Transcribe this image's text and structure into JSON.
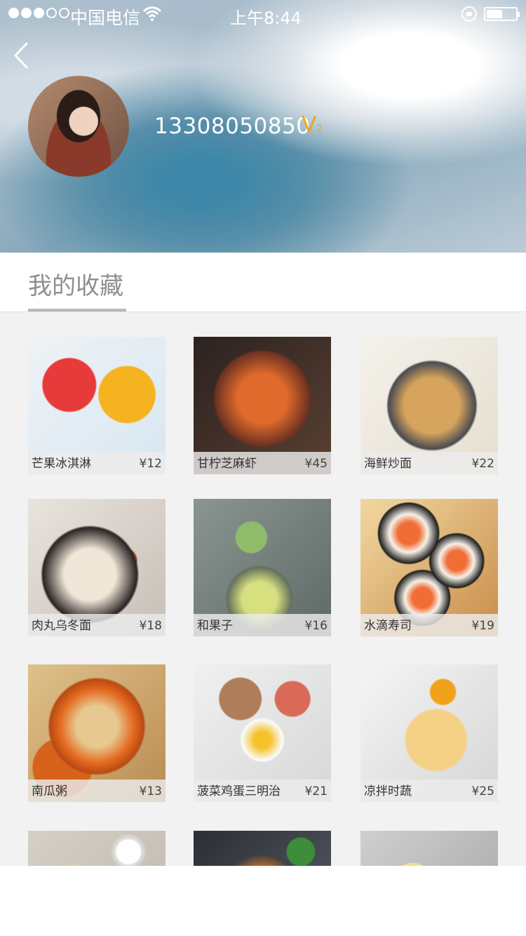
{
  "status_bar": {
    "carrier": "中国电信",
    "time": "上午8:44",
    "signal_bars": 3,
    "battery_level": 0.45
  },
  "profile": {
    "phone": "13308050850",
    "vip": "V",
    "vip_level": "2"
  },
  "section": {
    "title": "我的收藏"
  },
  "favorites": [
    {
      "name": "芒果冰淇淋",
      "price": "¥12"
    },
    {
      "name": "甘柠芝麻虾",
      "price": "¥45"
    },
    {
      "name": "海鲜炒面",
      "price": "¥22"
    },
    {
      "name": "肉丸乌冬面",
      "price": "¥18"
    },
    {
      "name": "和果子",
      "price": "¥16"
    },
    {
      "name": "水滴寿司",
      "price": "¥19"
    },
    {
      "name": "南瓜粥",
      "price": "¥13"
    },
    {
      "name": "菠菜鸡蛋三明治",
      "price": "¥21"
    },
    {
      "name": "凉拌时蔬",
      "price": "¥25"
    }
  ],
  "icons": {
    "back": "back-icon",
    "wifi": "wifi-icon",
    "lock": "rotation-lock-icon",
    "battery": "battery-icon"
  },
  "colors": {
    "accent": "#f0a321",
    "section_title": "#8f8f8f",
    "background": "#f2f2f2"
  }
}
